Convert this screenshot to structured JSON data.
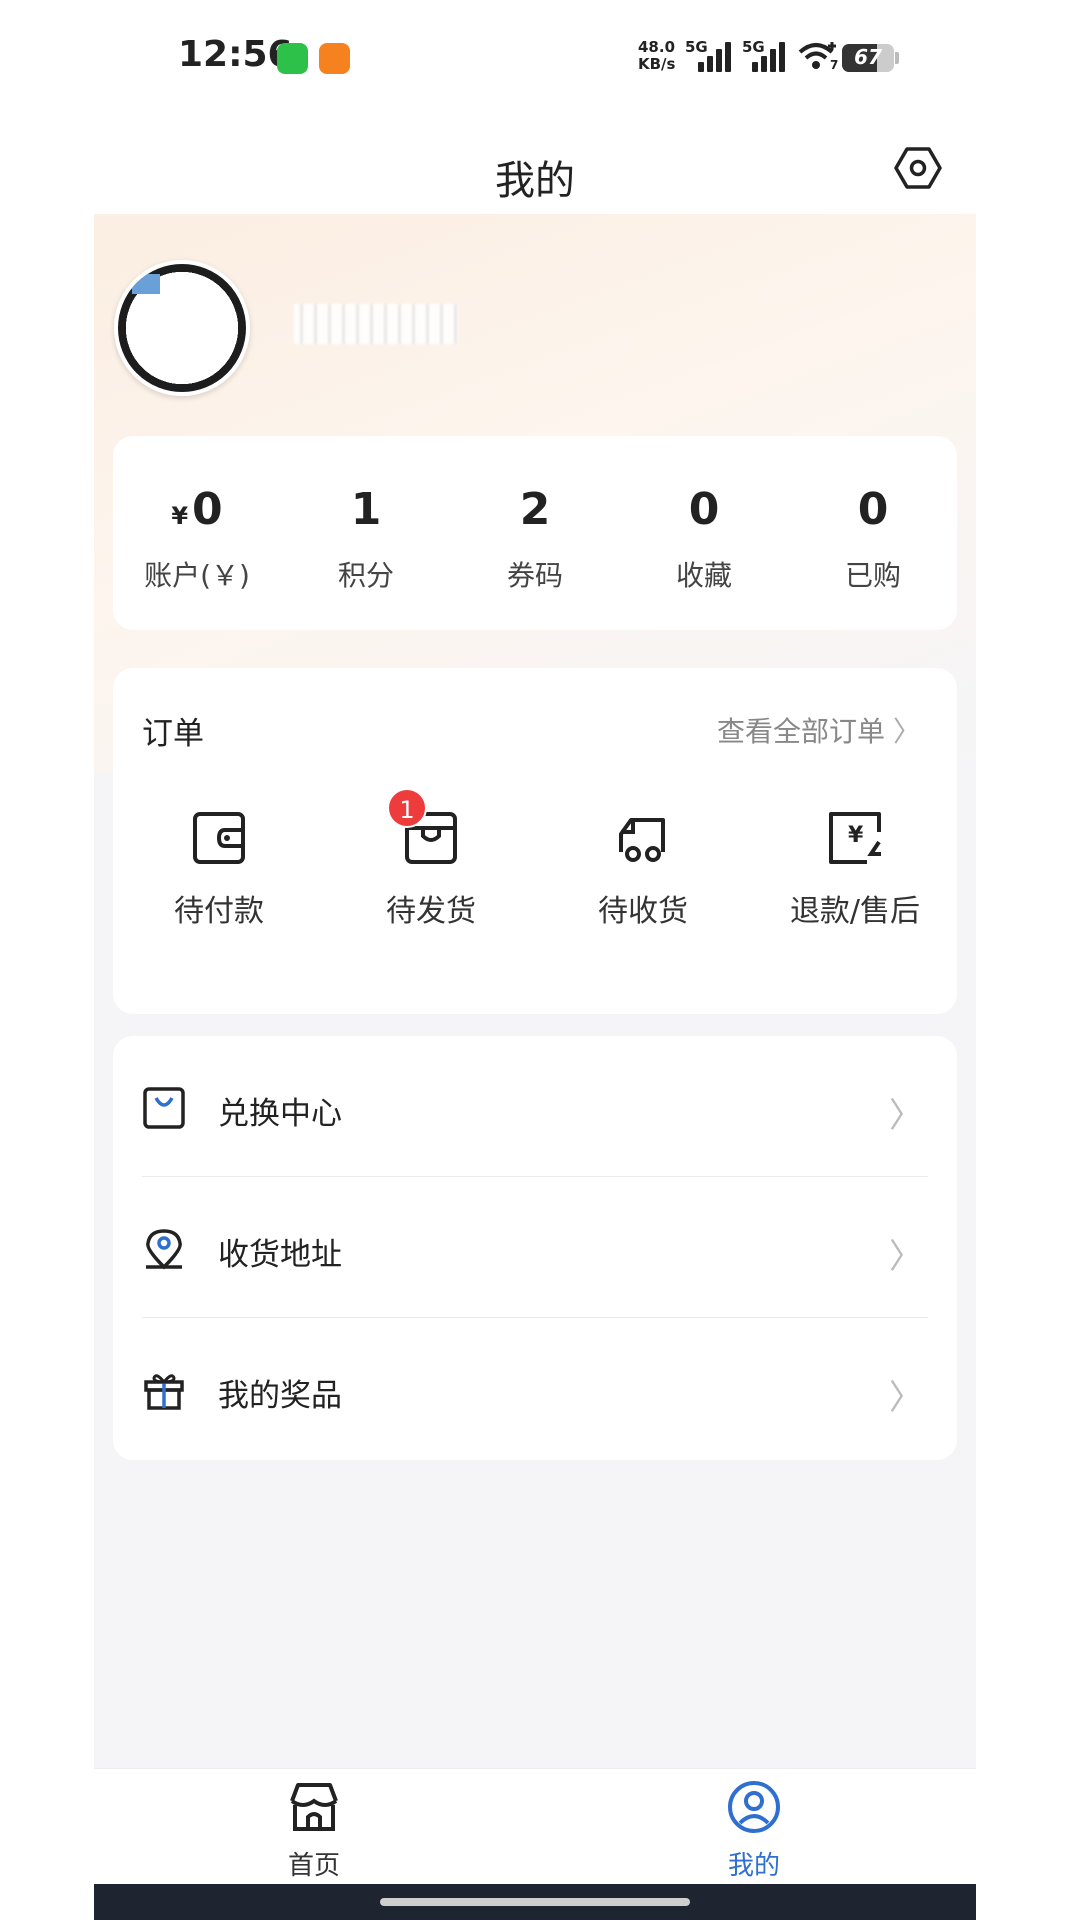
{
  "status_bar": {
    "time": "12:56",
    "net_speed_value": "48.0",
    "net_speed_unit": "KB/s",
    "signal_1_label": "5G",
    "signal_2_label": "5G",
    "wifi_sub": "7",
    "battery": "67",
    "battery_level": 0.67
  },
  "header": {
    "title": "我的",
    "settings_icon": "settings-hexagon-icon"
  },
  "stats": [
    {
      "currency": "¥",
      "value": "0",
      "label": "账户(￥)"
    },
    {
      "value": "1",
      "label": "积分"
    },
    {
      "value": "2",
      "label": "券码"
    },
    {
      "value": "0",
      "label": "收藏"
    },
    {
      "value": "0",
      "label": "已购"
    }
  ],
  "orders": {
    "title": "订单",
    "view_all": "查看全部订单",
    "items": [
      {
        "label": "待付款",
        "icon": "wallet-icon"
      },
      {
        "label": "待发货",
        "icon": "package-icon",
        "badge": "1"
      },
      {
        "label": "待收货",
        "icon": "truck-icon"
      },
      {
        "label": "退款/售后",
        "icon": "refund-icon"
      }
    ]
  },
  "menu": [
    {
      "label": "兑换中心",
      "icon": "shopping-bag-icon"
    },
    {
      "label": "收货地址",
      "icon": "location-pin-icon"
    },
    {
      "label": "我的奖品",
      "icon": "gift-icon"
    }
  ],
  "tabbar": {
    "items": [
      {
        "label": "首页",
        "icon": "store-icon",
        "active": false
      },
      {
        "label": "我的",
        "icon": "user-circle-icon",
        "active": true
      }
    ],
    "active_color": "#2f6fd0",
    "inactive_color": "#333333"
  }
}
